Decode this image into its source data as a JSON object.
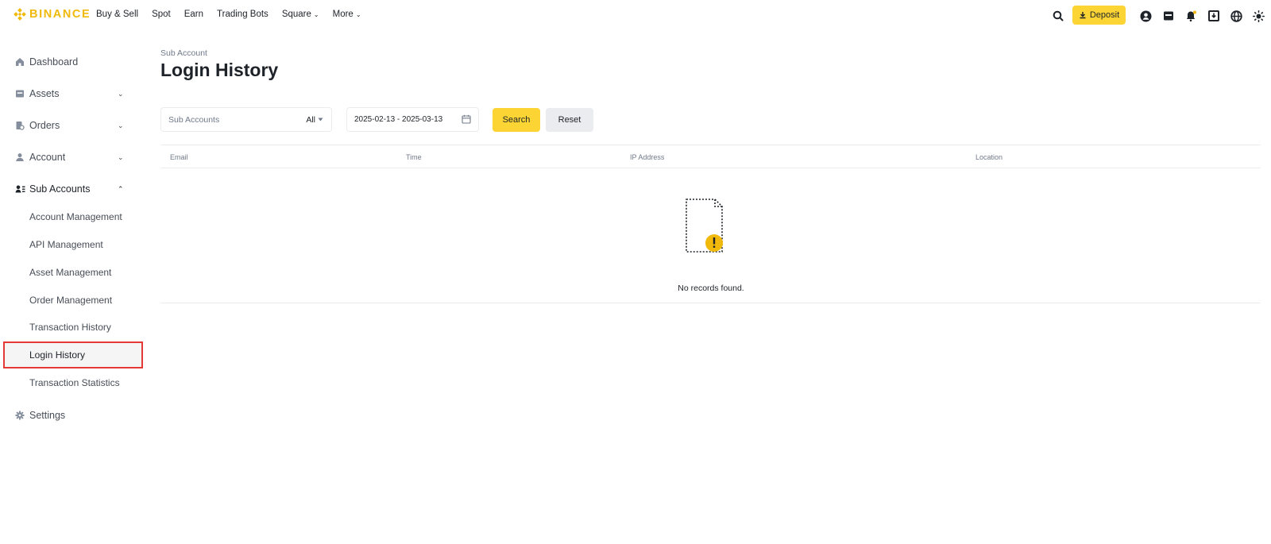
{
  "brand": {
    "name": "BINANCE",
    "color": "#F0B90B"
  },
  "nav": {
    "items": [
      {
        "label": "Buy & Sell",
        "dropdown": false
      },
      {
        "label": "Spot",
        "dropdown": false
      },
      {
        "label": "Earn",
        "dropdown": false
      },
      {
        "label": "Trading Bots",
        "dropdown": false
      },
      {
        "label": "Square",
        "dropdown": true
      },
      {
        "label": "More",
        "dropdown": true
      }
    ],
    "deposit_label": "Deposit",
    "icons": [
      "search-icon",
      "download-icon",
      "user-icon",
      "wallet-icon",
      "bell-icon",
      "download-app-icon",
      "globe-icon",
      "theme-icon"
    ]
  },
  "sidebar": {
    "items": [
      {
        "label": "Dashboard",
        "icon": "home-icon"
      },
      {
        "label": "Assets",
        "icon": "wallet-icon",
        "expandable": true
      },
      {
        "label": "Orders",
        "icon": "orders-icon",
        "expandable": true
      },
      {
        "label": "Account",
        "icon": "user-icon",
        "expandable": true
      },
      {
        "label": "Sub Accounts",
        "icon": "sub-accounts-icon",
        "expandable": true,
        "expanded": true
      },
      {
        "label": "Settings",
        "icon": "gear-icon"
      }
    ],
    "sub_items": [
      {
        "label": "Account Management"
      },
      {
        "label": "API Management"
      },
      {
        "label": "Asset Management"
      },
      {
        "label": "Order Management"
      },
      {
        "label": "Transaction History"
      },
      {
        "label": "Login History",
        "active": true
      },
      {
        "label": "Transaction Statistics"
      }
    ]
  },
  "main": {
    "breadcrumb": "Sub Account",
    "title": "Login History",
    "filters": {
      "sub_accounts_placeholder": "Sub Accounts",
      "sub_accounts_value": "All",
      "date_range": "2025-02-13 - 2025-03-13",
      "search_label": "Search",
      "reset_label": "Reset"
    },
    "table": {
      "columns": [
        "Email",
        "Time",
        "IP Address",
        "Location"
      ],
      "rows": [],
      "empty_text": "No records found."
    }
  },
  "colors": {
    "accent": "#FCD535",
    "highlight_border": "#E53935"
  }
}
